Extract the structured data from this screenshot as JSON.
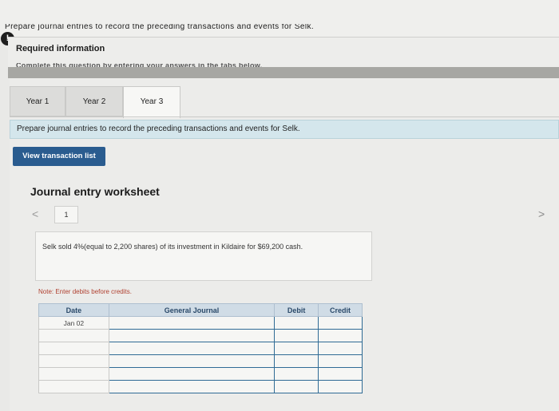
{
  "header": {
    "cutoff_text": "Prepare journal entries to record the preceding transactions and events for Selk.",
    "alert_badge": "!"
  },
  "required": {
    "title": "Required information",
    "subtitle": "Complete this question by entering your answers in the tabs below."
  },
  "tabs": [
    {
      "label": "Year 1",
      "active": false
    },
    {
      "label": "Year 2",
      "active": false
    },
    {
      "label": "Year 3",
      "active": true
    }
  ],
  "instruction": "Prepare journal entries to record the preceding transactions and events for Selk.",
  "view_button": "View transaction list",
  "worksheet": {
    "title": "Journal entry worksheet",
    "page": "1",
    "nav_prev": "<",
    "nav_next": ">",
    "description": "Selk sold 4%(equal to 2,200 shares) of its investment in Kildaire for $69,200 cash.",
    "note": "Note: Enter debits before credits."
  },
  "journal_table": {
    "headers": [
      "Date",
      "General Journal",
      "Debit",
      "Credit"
    ],
    "rows": [
      {
        "date": "Jan 02"
      },
      {
        "date": ""
      },
      {
        "date": ""
      },
      {
        "date": ""
      },
      {
        "date": ""
      },
      {
        "date": ""
      }
    ]
  }
}
